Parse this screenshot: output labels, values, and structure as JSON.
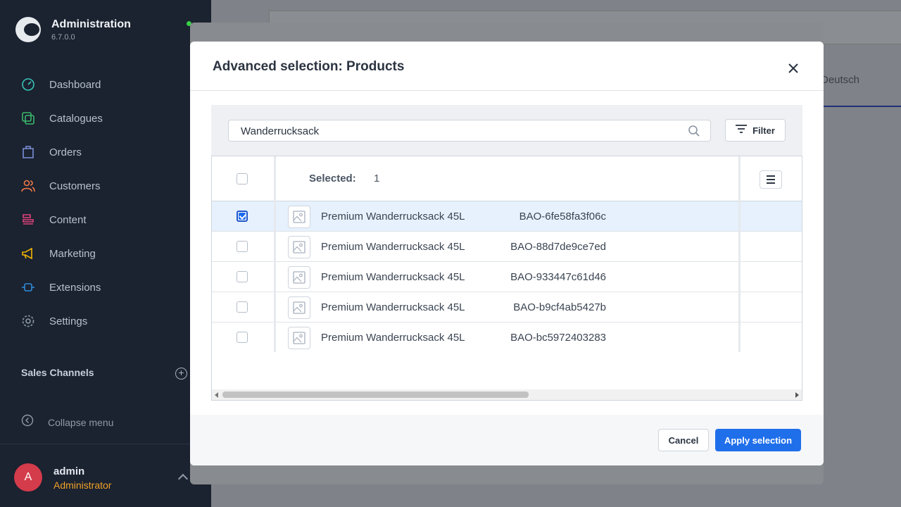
{
  "app": {
    "title": "Administration",
    "version": "6.7.0.0"
  },
  "nav": [
    {
      "label": "Dashboard",
      "icon": "dashboard-icon",
      "color": "#37c6ba"
    },
    {
      "label": "Catalogues",
      "icon": "catalogue-icon",
      "color": "#3bb96b"
    },
    {
      "label": "Orders",
      "icon": "orders-icon",
      "color": "#7b8fd8"
    },
    {
      "label": "Customers",
      "icon": "customers-icon",
      "color": "#ef7a48"
    },
    {
      "label": "Content",
      "icon": "content-icon",
      "color": "#e0427a"
    },
    {
      "label": "Marketing",
      "icon": "marketing-icon",
      "color": "#f0b400"
    },
    {
      "label": "Extensions",
      "icon": "extensions-icon",
      "color": "#2f8bd8"
    },
    {
      "label": "Settings",
      "icon": "settings-icon",
      "color": "#8f9aa8"
    }
  ],
  "sales_channels": {
    "title": "Sales Channels"
  },
  "collapse_menu": "Collapse menu",
  "user": {
    "initial": "A",
    "name": "admin",
    "role": "Administrator"
  },
  "background": {
    "language": "Deutsch"
  },
  "modal": {
    "title": "Advanced selection: Products",
    "search_value": "Wanderrucksack",
    "filter_label": "Filter",
    "selected_label": "Selected:",
    "selected_count": "1",
    "cancel_label": "Cancel",
    "apply_label": "Apply selection"
  },
  "rows": [
    {
      "name": "Premium Wanderrucksack 45L",
      "number": "BAO-6fe58fa3f06c",
      "checked": true
    },
    {
      "name": "Premium Wanderrucksack 45L",
      "number": "BAO-88d7de9ce7ed",
      "checked": false
    },
    {
      "name": "Premium Wanderrucksack 45L",
      "number": "BAO-933447c61d46",
      "checked": false
    },
    {
      "name": "Premium Wanderrucksack 45L",
      "number": "BAO-b9cf4ab5427b",
      "checked": false
    },
    {
      "name": "Premium Wanderrucksack 45L",
      "number": "BAO-bc5972403283",
      "checked": false
    }
  ],
  "colors": {
    "primary": "#1f6feb",
    "sidebar": "#1b2230",
    "selected_row": "#e6f1fd",
    "role": "#f0a127",
    "avatar": "#d43b4b"
  }
}
